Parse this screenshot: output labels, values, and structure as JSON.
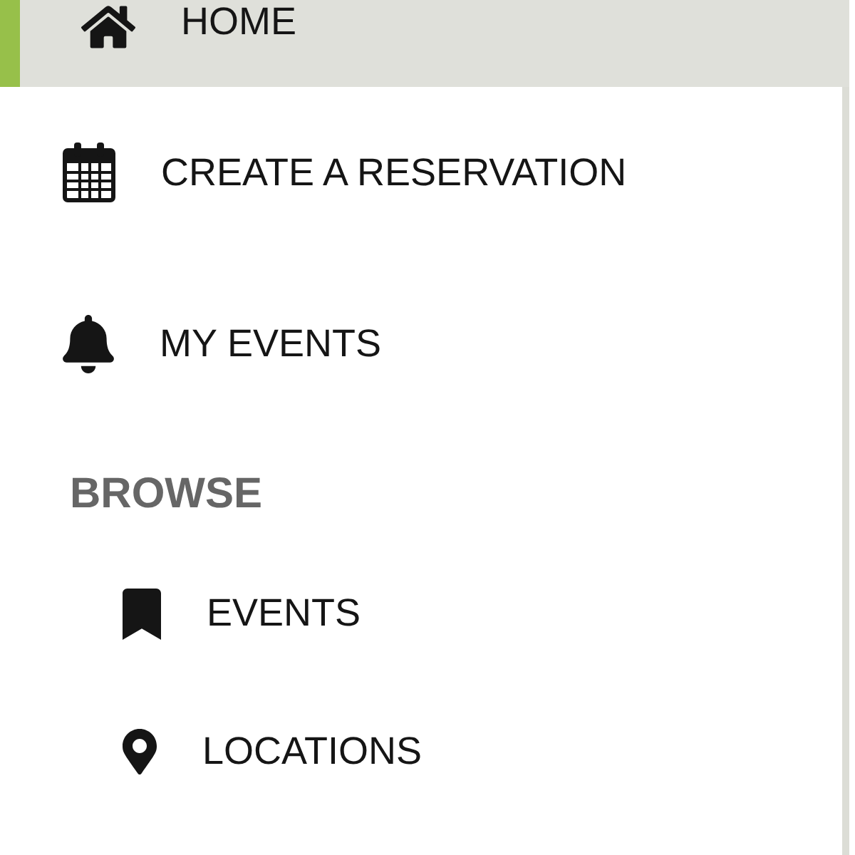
{
  "menu": [
    {
      "label": "HOME",
      "selected": true
    },
    {
      "label": "CREATE A RESERVATION",
      "selected": false
    },
    {
      "label": "MY EVENTS",
      "selected": false
    }
  ],
  "browse": {
    "heading": "BROWSE",
    "items": [
      {
        "label": "EVENTS",
        "selected": false
      },
      {
        "label": "LOCATIONS",
        "selected": false
      }
    ]
  }
}
